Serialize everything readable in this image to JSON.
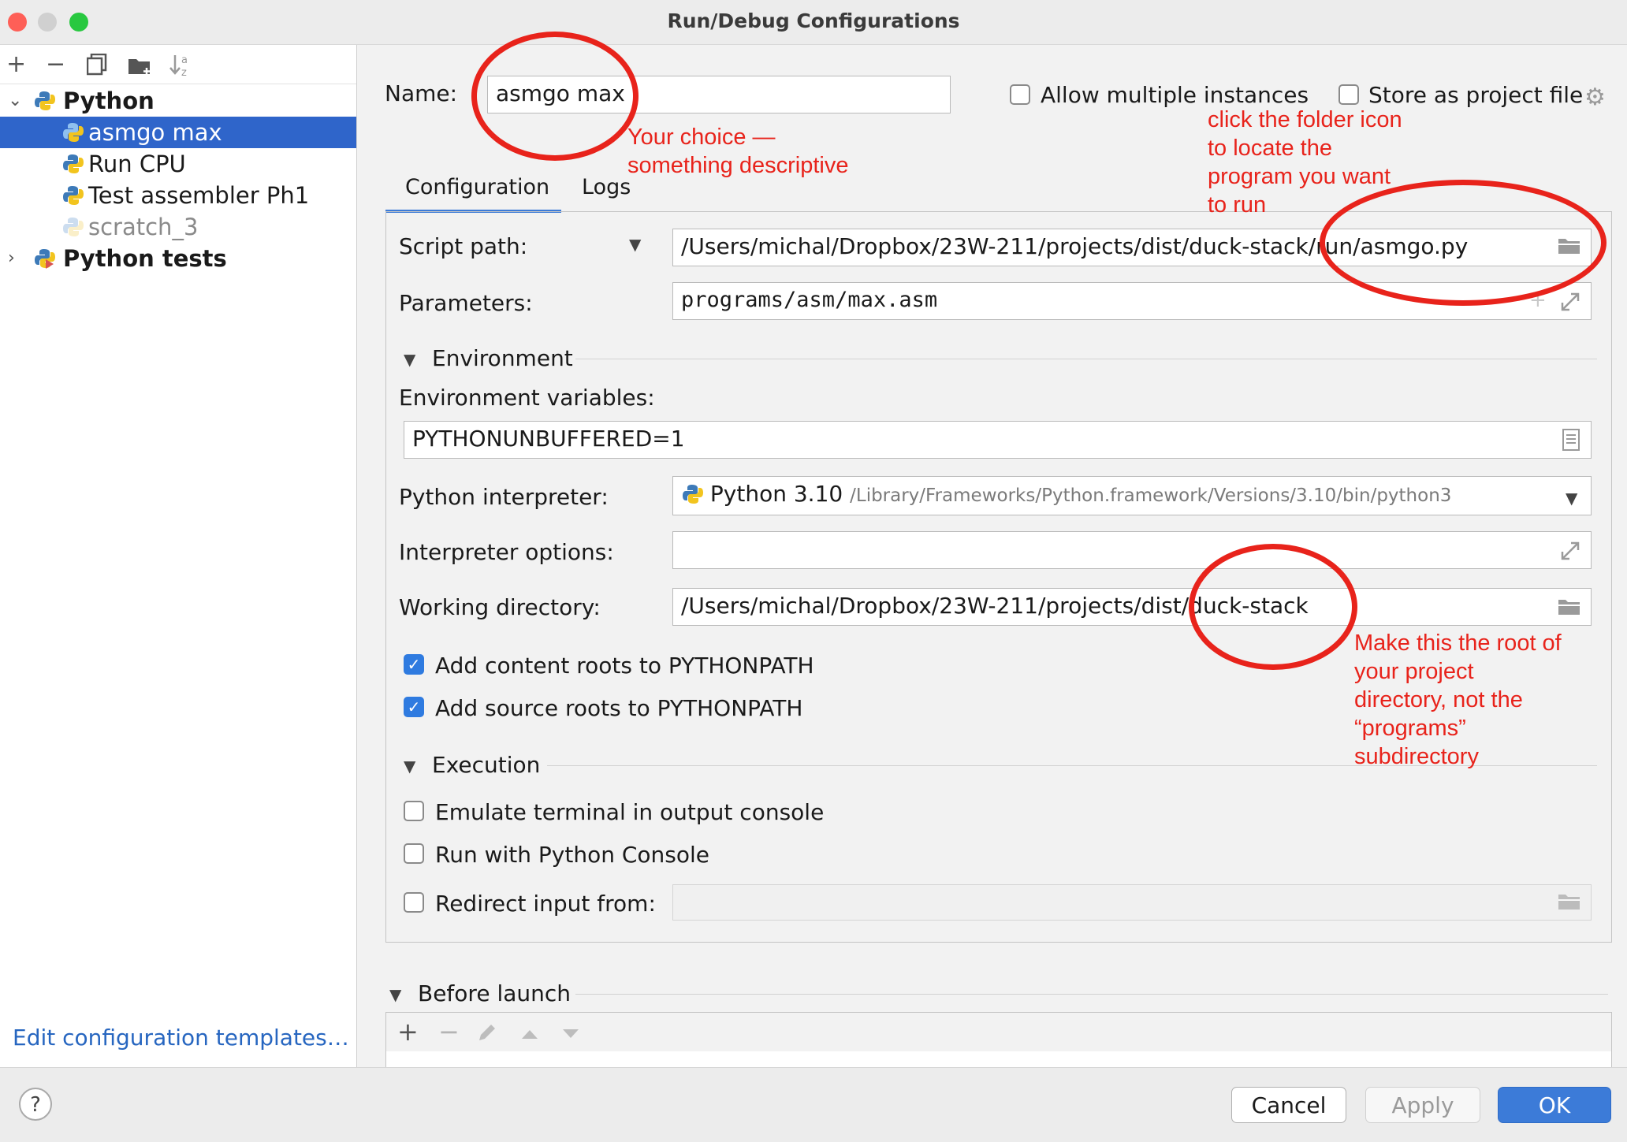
{
  "window": {
    "title": "Run/Debug Configurations"
  },
  "sidebar": {
    "toolbar": [
      {
        "name": "add-config-button",
        "icon": "+"
      },
      {
        "name": "remove-config-button",
        "icon": "−"
      },
      {
        "name": "copy-config-button",
        "icon": "⎘"
      },
      {
        "name": "move-to-folder-button",
        "icon": "▆"
      },
      {
        "name": "sort-button",
        "icon": "⇣"
      }
    ],
    "tree": {
      "python_group": "Python",
      "items": [
        "asmgo max",
        "Run CPU",
        "Test assembler Ph1",
        "scratch_3"
      ],
      "python_tests_group": "Python tests"
    },
    "edit_templates": "Edit configuration templates…"
  },
  "form": {
    "name_label": "Name:",
    "name_value": "asmgo max",
    "allow_multiple": "Allow multiple instances",
    "store_as_project": "Store as project file",
    "tabs": [
      "Configuration",
      "Logs"
    ],
    "script_path_label": "Script path:",
    "script_path_value": "/Users/michal/Dropbox/23W-211/projects/dist/duck-stack/run/asmgo.py",
    "parameters_label": "Parameters:",
    "parameters_value": "programs/asm/max.asm",
    "environment_section": "Environment",
    "env_vars_label": "Environment variables:",
    "env_vars_value": "PYTHONUNBUFFERED=1",
    "interpreter_label": "Python interpreter:",
    "interpreter_name": "Python 3.10",
    "interpreter_path": "/Library/Frameworks/Python.framework/Versions/3.10/bin/python3",
    "interp_options_label": "Interpreter options:",
    "interp_options_value": "",
    "workdir_label": "Working directory:",
    "workdir_value": "/Users/michal/Dropbox/23W-211/projects/dist/duck-stack",
    "add_content_roots": "Add content roots to PYTHONPATH",
    "add_source_roots": "Add source roots to PYTHONPATH",
    "execution_section": "Execution",
    "emulate_terminal": "Emulate terminal in output console",
    "run_with_console": "Run with Python Console",
    "redirect_input": "Redirect input from:",
    "redirect_value": "",
    "before_launch": "Before launch"
  },
  "annotations": {
    "name_note": [
      "Your choice —",
      "something descriptive"
    ],
    "folder_note": [
      "click the folder icon",
      "to locate the",
      "program you want",
      "to run"
    ],
    "workdir_note": [
      "Make this the root of",
      "your project",
      "directory, not the",
      "“programs”",
      "subdirectory"
    ]
  },
  "buttons": {
    "help": "?",
    "cancel": "Cancel",
    "apply": "Apply",
    "ok": "OK"
  },
  "colors": {
    "accent": "#3c7bd8",
    "selection": "#2f65ca",
    "annotation": "#e8231b"
  }
}
